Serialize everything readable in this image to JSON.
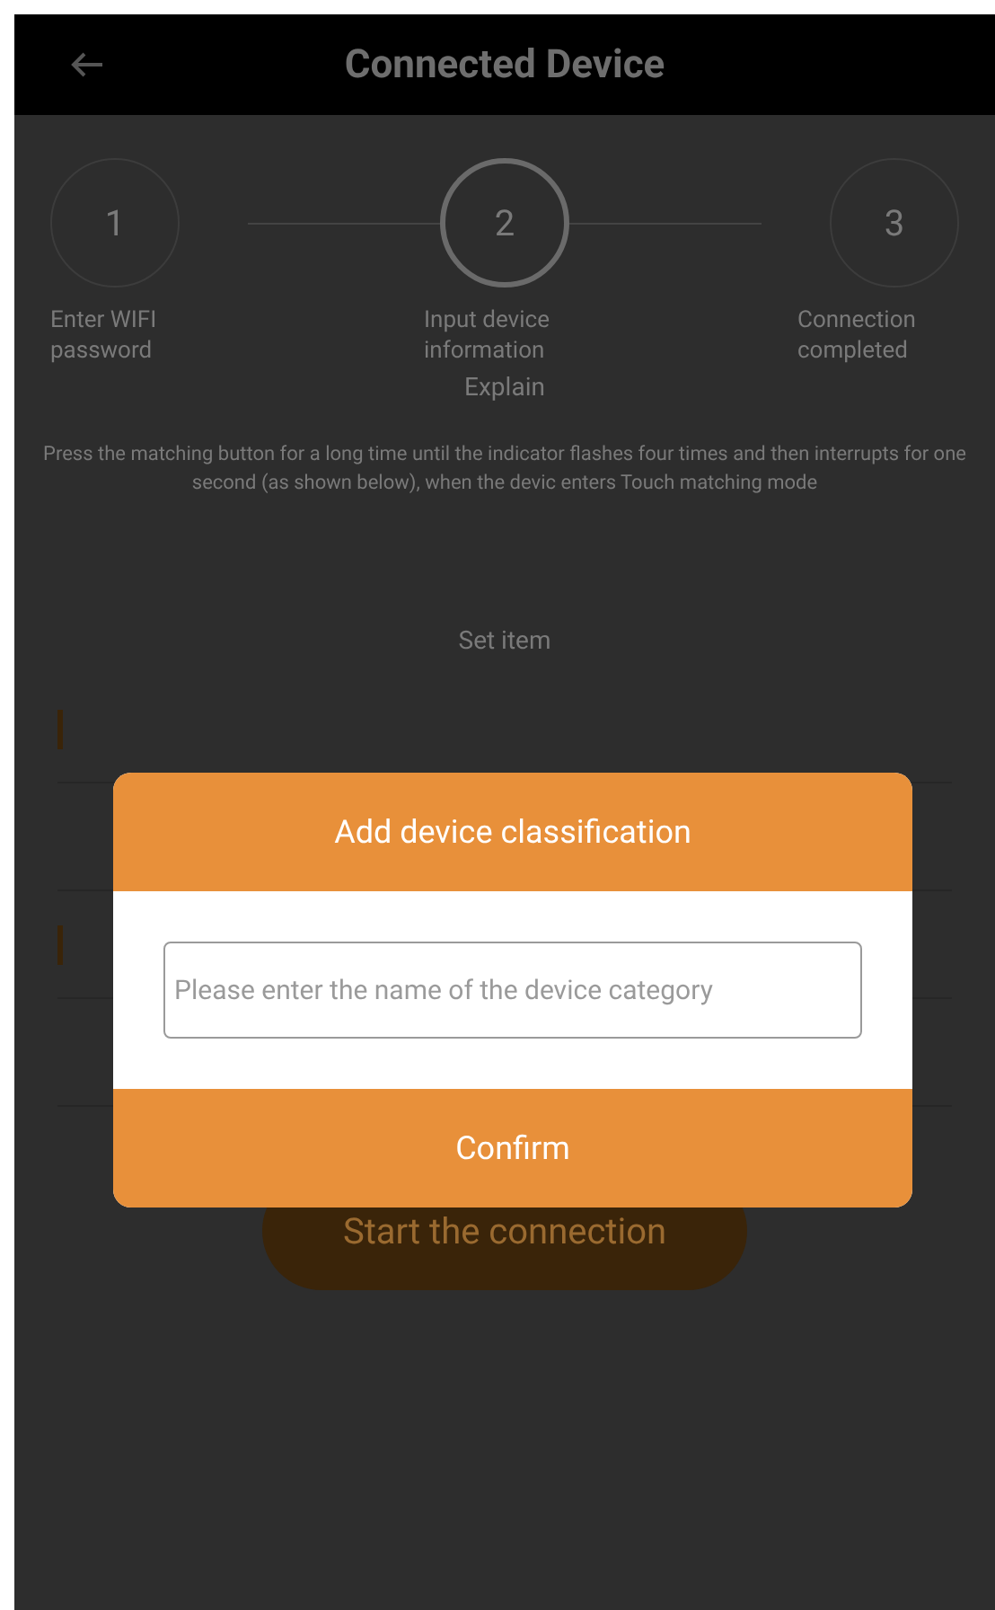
{
  "header": {
    "title": "Connected Device"
  },
  "steps": [
    {
      "number": "1",
      "label": "Enter WIFI password",
      "selected": false
    },
    {
      "number": "2",
      "label": "Input device information",
      "selected": true
    },
    {
      "number": "3",
      "label": "Connection completed",
      "selected": false
    }
  ],
  "explain": {
    "title": "Explain",
    "text": "Press the matching button for a long time until the indicator flashes four times and then interrupts for one second (as shown below), when the devic enters Touch matching mode"
  },
  "section": {
    "title": "Set item"
  },
  "start_button": "Start the connection",
  "dialog": {
    "title": "Add device classification",
    "placeholder": "Please enter the name of the device category",
    "confirm": "Confirm"
  }
}
